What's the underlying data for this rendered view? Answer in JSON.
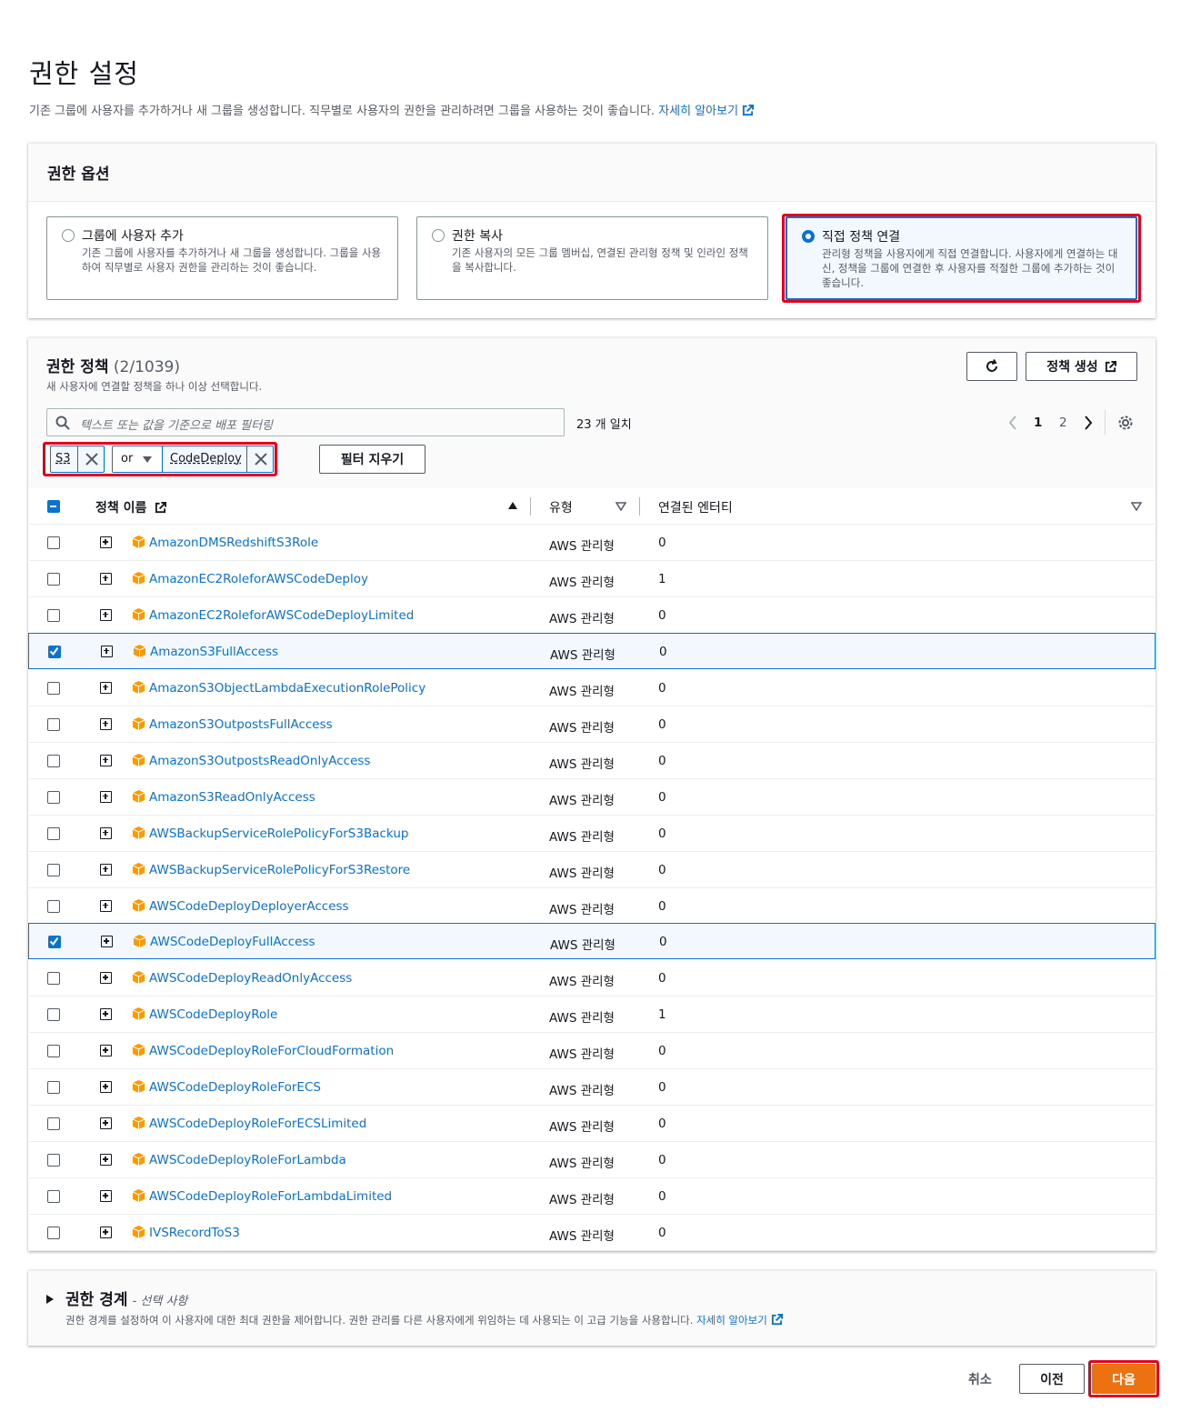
{
  "page": {
    "title": "권한 설정",
    "subtitle": "기존 그룹에 사용자를 추가하거나 새 그룹을 생성합니다. 직무별로 사용자의 권한을 관리하려면 그룹을 사용하는 것이 좋습니다.",
    "learn_more": "자세히 알아보기"
  },
  "options": {
    "title": "권한 옵션",
    "cards": [
      {
        "title": "그룹에 사용자 추가",
        "desc": "기존 그룹에 사용자를 추가하거나 새 그룹을 생성합니다. 그룹을 사용하여 직무별로 사용자 권한을 관리하는 것이 좋습니다.",
        "selected": false
      },
      {
        "title": "권한 복사",
        "desc": "기존 사용자의 모든 그룹 멤버십, 연결된 관리형 정책 및 인라인 정책을 복사합니다.",
        "selected": false
      },
      {
        "title": "직접 정책 연결",
        "desc": "관리형 정책을 사용자에게 직접 연결합니다. 사용자에게 연결하는 대신, 정책을 그룹에 연결한 후 사용자를 적절한 그룹에 추가하는 것이 좋습니다.",
        "selected": true
      }
    ]
  },
  "policies": {
    "title": "권한 정책",
    "count": "(2/1039)",
    "desc": "새 사용자에 연결할 정책을 하나 이상 선택합니다.",
    "create_button": "정책 생성",
    "search_placeholder": "텍스트 또는 값을 기준으로 배포 필터링",
    "match_count": "23 개 일치",
    "pages": [
      "1",
      "2"
    ],
    "current_page": "1",
    "tokens": {
      "first": "S3",
      "operator": "or",
      "second": "CodeDeploy"
    },
    "clear_filter": "필터 지우기",
    "columns": {
      "name": "정책 이름",
      "type": "유형",
      "entities": "연결된 엔터티"
    },
    "rows": [
      {
        "name": "AmazonDMSRedshiftS3Role",
        "type": "AWS 관리형",
        "entities": "0",
        "checked": false
      },
      {
        "name": "AmazonEC2RoleforAWSCodeDeploy",
        "type": "AWS 관리형",
        "entities": "1",
        "checked": false
      },
      {
        "name": "AmazonEC2RoleforAWSCodeDeployLimited",
        "type": "AWS 관리형",
        "entities": "0",
        "checked": false
      },
      {
        "name": "AmazonS3FullAccess",
        "type": "AWS 관리형",
        "entities": "0",
        "checked": true
      },
      {
        "name": "AmazonS3ObjectLambdaExecutionRolePolicy",
        "type": "AWS 관리형",
        "entities": "0",
        "checked": false
      },
      {
        "name": "AmazonS3OutpostsFullAccess",
        "type": "AWS 관리형",
        "entities": "0",
        "checked": false
      },
      {
        "name": "AmazonS3OutpostsReadOnlyAccess",
        "type": "AWS 관리형",
        "entities": "0",
        "checked": false
      },
      {
        "name": "AmazonS3ReadOnlyAccess",
        "type": "AWS 관리형",
        "entities": "0",
        "checked": false
      },
      {
        "name": "AWSBackupServiceRolePolicyForS3Backup",
        "type": "AWS 관리형",
        "entities": "0",
        "checked": false
      },
      {
        "name": "AWSBackupServiceRolePolicyForS3Restore",
        "type": "AWS 관리형",
        "entities": "0",
        "checked": false
      },
      {
        "name": "AWSCodeDeployDeployerAccess",
        "type": "AWS 관리형",
        "entities": "0",
        "checked": false
      },
      {
        "name": "AWSCodeDeployFullAccess",
        "type": "AWS 관리형",
        "entities": "0",
        "checked": true
      },
      {
        "name": "AWSCodeDeployReadOnlyAccess",
        "type": "AWS 관리형",
        "entities": "0",
        "checked": false
      },
      {
        "name": "AWSCodeDeployRole",
        "type": "AWS 관리형",
        "entities": "1",
        "checked": false
      },
      {
        "name": "AWSCodeDeployRoleForCloudFormation",
        "type": "AWS 관리형",
        "entities": "0",
        "checked": false
      },
      {
        "name": "AWSCodeDeployRoleForECS",
        "type": "AWS 관리형",
        "entities": "0",
        "checked": false
      },
      {
        "name": "AWSCodeDeployRoleForECSLimited",
        "type": "AWS 관리형",
        "entities": "0",
        "checked": false
      },
      {
        "name": "AWSCodeDeployRoleForLambda",
        "type": "AWS 관리형",
        "entities": "0",
        "checked": false
      },
      {
        "name": "AWSCodeDeployRoleForLambdaLimited",
        "type": "AWS 관리형",
        "entities": "0",
        "checked": false
      },
      {
        "name": "IVSRecordToS3",
        "type": "AWS 관리형",
        "entities": "0",
        "checked": false
      }
    ]
  },
  "boundary": {
    "title": "권한 경계",
    "optional": "- 선택 사항",
    "desc": "권한 경계를 설정하여 이 사용자에 대한 최대 권한을 제어합니다. 권한 관리를 다른 사용자에게 위임하는 데 사용되는 이 고급 기능을 사용합니다.",
    "learn_more": "자세히 알아보기"
  },
  "footer": {
    "cancel": "취소",
    "previous": "이전",
    "next": "다음"
  },
  "colors": {
    "link": "#0972d3",
    "primary": "#ec7211",
    "highlight": "#e3001b",
    "cube": "#f90"
  }
}
